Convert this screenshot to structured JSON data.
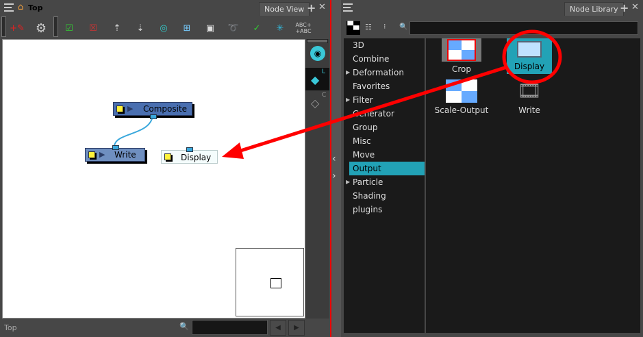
{
  "left_panel": {
    "breadcrumb": "Top",
    "tab": "Node View",
    "toolbar": [
      "add-drawing-icon",
      "gear-icon",
      "enable-icon",
      "disable-icon",
      "move-up-icon",
      "move-down-icon",
      "zoom-fit-icon",
      "group-icon",
      "backdrop-icon",
      "lasso-icon",
      "check-icon",
      "cable-icon",
      "rename-icon"
    ],
    "rename_label": "ABC+\n+ABC",
    "nodes": [
      {
        "label": "Composite"
      },
      {
        "label": "Write"
      },
      {
        "label": "Display"
      }
    ],
    "side_buttons": {
      "layer_l": "L",
      "layer_c": "C"
    },
    "status": "Top",
    "search_value": ""
  },
  "right_panel": {
    "tab": "Node Library",
    "search_value": "",
    "categories": [
      {
        "label": "3D"
      },
      {
        "label": "Combine"
      },
      {
        "label": "Deformation",
        "expandable": true
      },
      {
        "label": "Favorites"
      },
      {
        "label": "Filter",
        "expandable": true
      },
      {
        "label": "Generator"
      },
      {
        "label": "Group"
      },
      {
        "label": "Misc"
      },
      {
        "label": "Move"
      },
      {
        "label": "Output",
        "selected": true
      },
      {
        "label": "Particle",
        "expandable": true
      },
      {
        "label": "Shading"
      },
      {
        "label": "plugins"
      }
    ],
    "nodes": [
      {
        "label": "Crop"
      },
      {
        "label": "Display",
        "selected": true
      },
      {
        "label": "Scale-Output"
      },
      {
        "label": "Write"
      }
    ]
  },
  "colors": {
    "accent": "#22a2b6",
    "annotation": "#ff0000",
    "node": "#4a6fb0"
  }
}
